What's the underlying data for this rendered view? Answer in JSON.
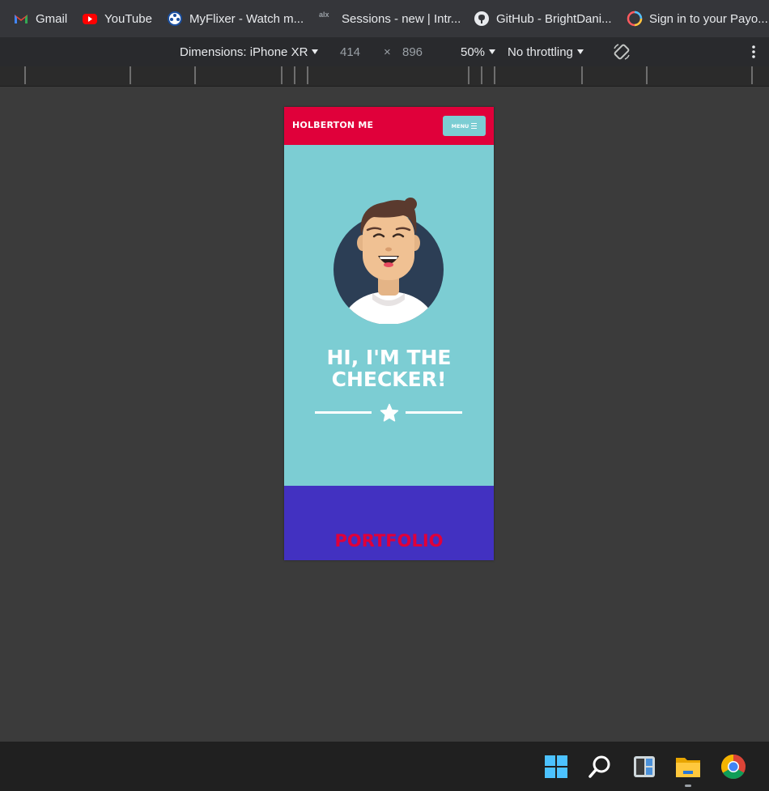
{
  "bookmarks": [
    {
      "label": "Gmail",
      "icon": "gmail-icon"
    },
    {
      "label": "YouTube",
      "icon": "youtube-icon"
    },
    {
      "label": "MyFlixer - Watch m...",
      "icon": "film-reel-icon"
    },
    {
      "label": "Sessions - new | Intr...",
      "icon": "alx-icon"
    },
    {
      "label": "GitHub - BrightDani...",
      "icon": "github-icon"
    },
    {
      "label": "Sign in to your Payo...",
      "icon": "ring-icon"
    }
  ],
  "device_toolbar": {
    "dimensions_label": "Dimensions: iPhone XR",
    "width": "414",
    "times": "×",
    "height": "896",
    "zoom": "50%",
    "throttling": "No throttling"
  },
  "site": {
    "brand": "HOLBERTON ME",
    "menu_label": "MENU",
    "hero_line1": "HI, I'M THE",
    "hero_line2": "CHECKER!",
    "portfolio": "PORTFOLIO"
  },
  "colors": {
    "header": "#e0003a",
    "hero": "#7ccdd3",
    "portfolio": "#4231c1"
  },
  "taskbar": [
    "windows-start-icon",
    "search-icon",
    "widgets-icon",
    "file-explorer-icon",
    "chrome-icon"
  ]
}
